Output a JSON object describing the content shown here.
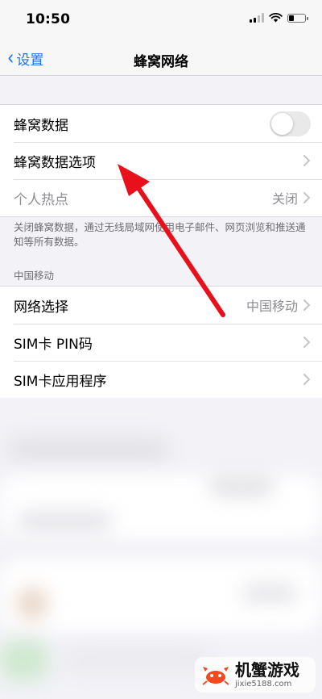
{
  "status_bar": {
    "time": "10:50",
    "icons": [
      "signal-icon",
      "wifi-icon",
      "battery-icon"
    ],
    "battery_level": 0.35
  },
  "nav_bar": {
    "back_label": "设置",
    "title": "蜂窝网络"
  },
  "cellular_group": {
    "rows": [
      {
        "label": "蜂窝数据",
        "toggle": "off"
      },
      {
        "label": "蜂窝数据选项"
      },
      {
        "label": "个人热点",
        "value": "关闭",
        "disabled": true
      }
    ]
  },
  "footer_note": "关闭蜂窝数据，通过无线局域网使用电子邮件、网页浏览和推送通知等所有数据。",
  "carrier_section": {
    "header": "中国移动",
    "rows": [
      {
        "label": "网络选择",
        "value": "中国移动"
      },
      {
        "label": "SIM卡 PIN码"
      },
      {
        "label": "SIM卡应用程序"
      }
    ]
  },
  "watermark": {
    "name": "机蟹游戏",
    "url": "jixie5188.com"
  },
  "colors": {
    "accent": "#1a73e8",
    "background": "#f2f2f7",
    "arrow": "#e8101a"
  }
}
